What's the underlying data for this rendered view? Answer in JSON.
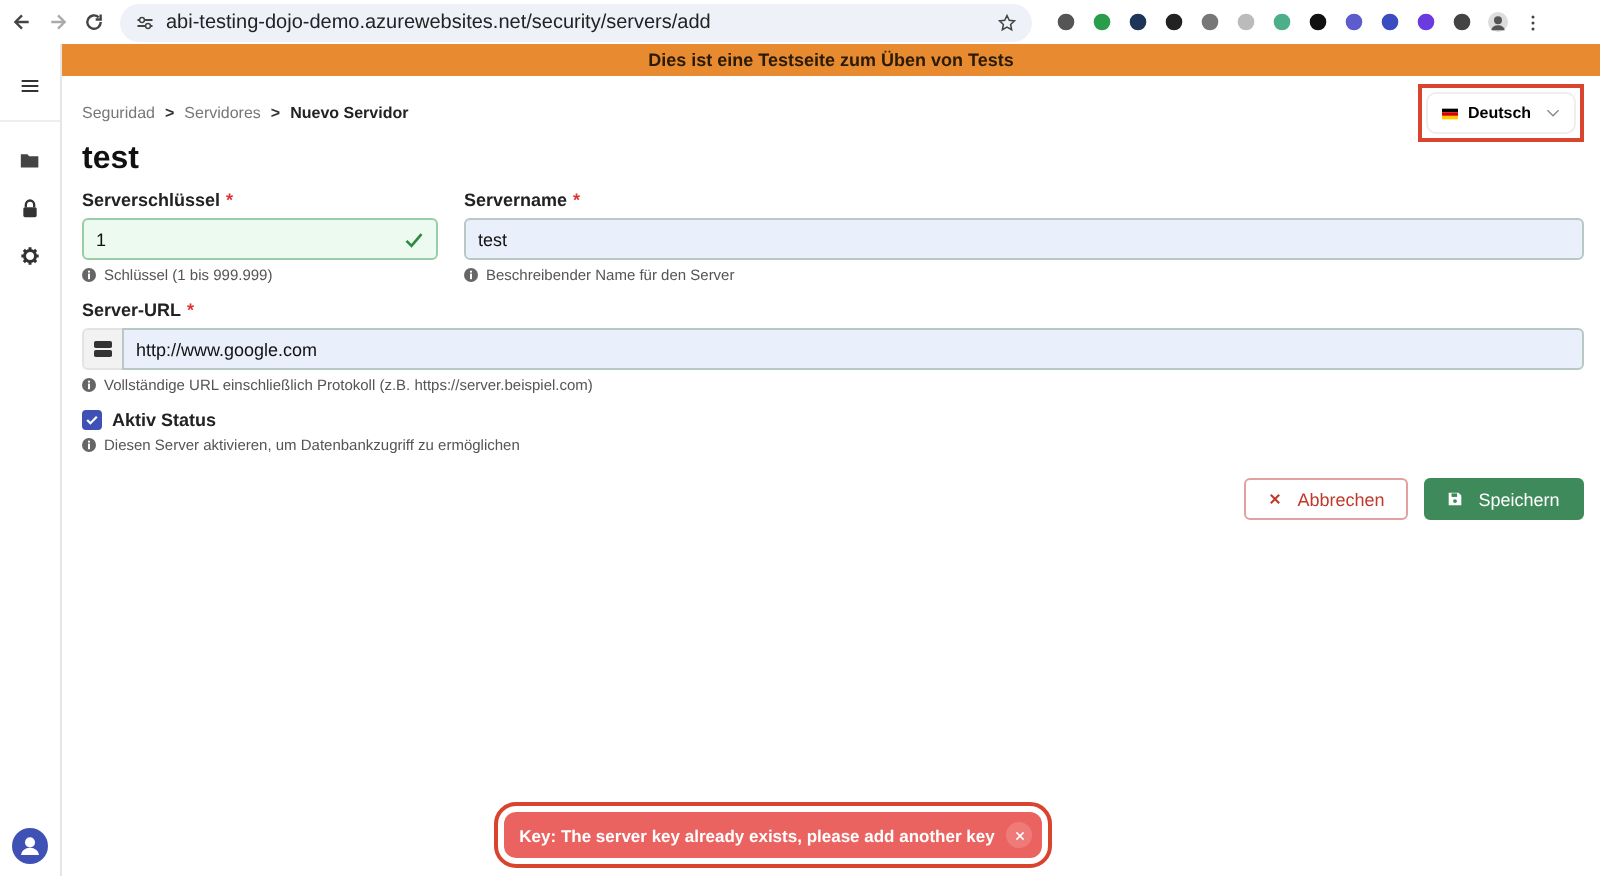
{
  "browser": {
    "url": "abi-testing-dojo-demo.azurewebsites.net/security/servers/add"
  },
  "banner": "Dies ist eine Testseite zum Üben von Tests",
  "breadcrumbs": [
    {
      "label": "Seguridad",
      "current": false
    },
    {
      "label": "Servidores",
      "current": false
    },
    {
      "label": "Nuevo Servidor",
      "current": true
    }
  ],
  "breadcrumb_separator": ">",
  "language": {
    "label": "Deutsch",
    "highlighted": true
  },
  "title": "test",
  "required_mark": "*",
  "fields": [
    {
      "label": "Serverschlüssel",
      "required": true,
      "value": "1",
      "valid": true,
      "hint": "Schlüssel (1 bis 999.999)"
    },
    {
      "label": "Servername",
      "required": true,
      "value": "test",
      "valid": false,
      "hint": "Beschreibender Name für den Server"
    }
  ],
  "url_field": {
    "label": "Server-URL",
    "required": true,
    "value": "http://www.google.com",
    "hint": "Vollständige URL einschließlich Protokoll (z.B. https://server.beispiel.com)"
  },
  "active": {
    "label": "Aktiv Status",
    "checked": true,
    "hint": "Diesen Server aktivieren, um Datenbankzugriff zu ermöglichen"
  },
  "buttons": [
    {
      "label": "Abbrechen",
      "kind": "cancel"
    },
    {
      "label": "Speichern",
      "kind": "save"
    }
  ],
  "toast": {
    "message": "Key: The server key already exists, please add another key",
    "highlighted": true
  }
}
